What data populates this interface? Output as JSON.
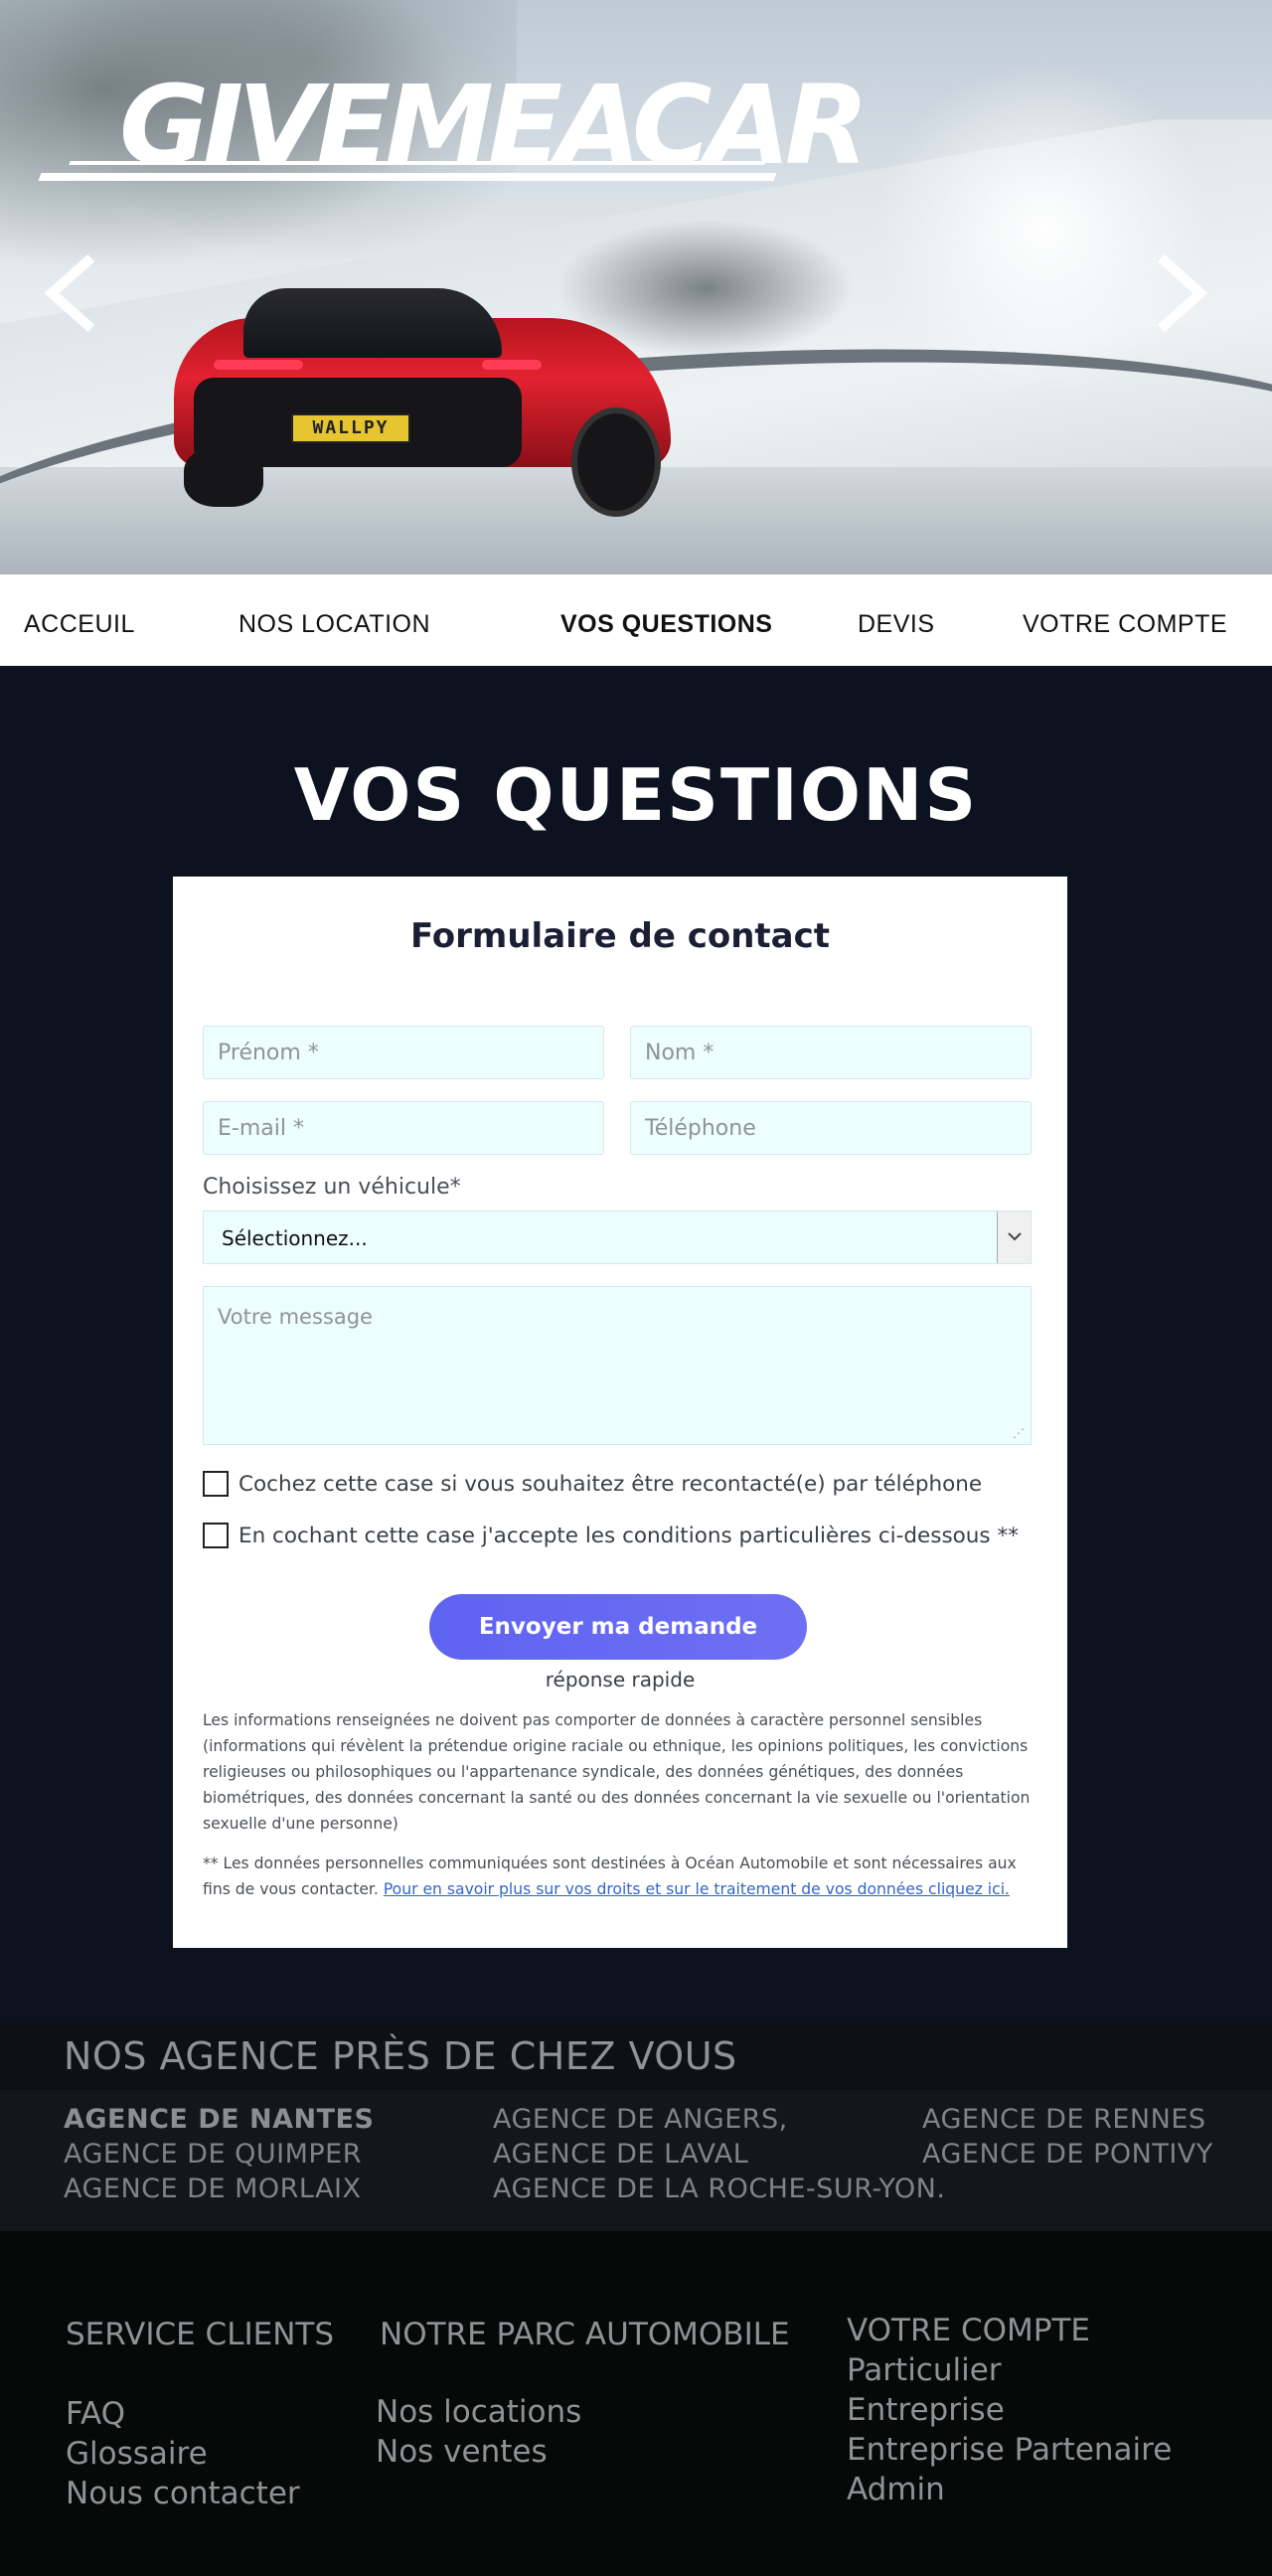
{
  "hero": {
    "logo_text": "GIVEMEACAR",
    "plate_text": "WALLPY",
    "prev_icon": "chevron-left-icon",
    "next_icon": "chevron-right-icon"
  },
  "nav": {
    "items": [
      "ACCEUIL",
      "NOS LOCATION",
      "VOS QUESTIONS",
      "DEVIS",
      "VOTRE COMPTE"
    ],
    "active": "VOS QUESTIONS"
  },
  "main": {
    "title": "VOS QUESTIONS"
  },
  "form": {
    "title": "Formulaire de contact",
    "firstname_placeholder": "Prénom *",
    "lastname_placeholder": "Nom *",
    "email_placeholder": "E-mail *",
    "phone_placeholder": "Téléphone",
    "vehicle_label": "Choisissez un véhicule*",
    "vehicle_selected": "Sélectionnez...",
    "message_placeholder": "Votre message",
    "callback_label": "Cochez cette case si vous souhaitez être recontacté(e) par téléphone",
    "accept_label": "En cochant cette case j'accepte les conditions particulières ci-dessous **",
    "submit_label": "Envoyer ma demande",
    "quick_text": "réponse rapide",
    "disclaimer_1": "Les informations renseignées ne doivent pas comporter de données à caractère personnel sensibles (informations qui révèlent la prétendue origine raciale ou ethnique, les opinions politiques, les convictions religieuses ou philosophiques ou l'appartenance syndicale, des données génétiques, des données biométriques, des données concernant la santé ou des données concernant la vie sexuelle ou l'orientation sexuelle d'une personne)",
    "disclaimer_2": "** Les données personnelles communiquées sont destinées à Océan Automobile et sont nécessaires aux fins de vous contacter. ",
    "disclaimer_link": "Pour en savoir plus sur vos droits et sur le traitement de vos données cliquez ici."
  },
  "agencies": {
    "title": "NOS AGENCE PRÈS DE CHEZ VOUS",
    "col1": [
      "AGENCE DE NANTES",
      "AGENCE DE QUIMPER",
      "AGENCE DE MORLAIX"
    ],
    "col2": [
      "AGENCE DE ANGERS,",
      "AGENCE DE LAVAL",
      "AGENCE DE LA ROCHE-SUR-YON."
    ],
    "col3": [
      "AGENCE DE RENNES",
      "AGENCE DE PONTIVY"
    ]
  },
  "footer": {
    "service": {
      "title": "SERVICE CLIENTS",
      "links": [
        "FAQ",
        "Glossaire",
        "Nous contacter"
      ]
    },
    "parc": {
      "title": "NOTRE PARC AUTOMOBILE",
      "links": [
        "Nos locations",
        "Nos ventes"
      ]
    },
    "account": {
      "title": "VOTRE COMPTE",
      "links": [
        "Particulier",
        "Entreprise",
        "Entreprise Partenaire",
        "Admin"
      ]
    }
  },
  "colors": {
    "page_bg": "#0c1220",
    "field_bg": "#edfefe",
    "submit_button": "#5e63f0",
    "footer_bg": "#070808"
  }
}
